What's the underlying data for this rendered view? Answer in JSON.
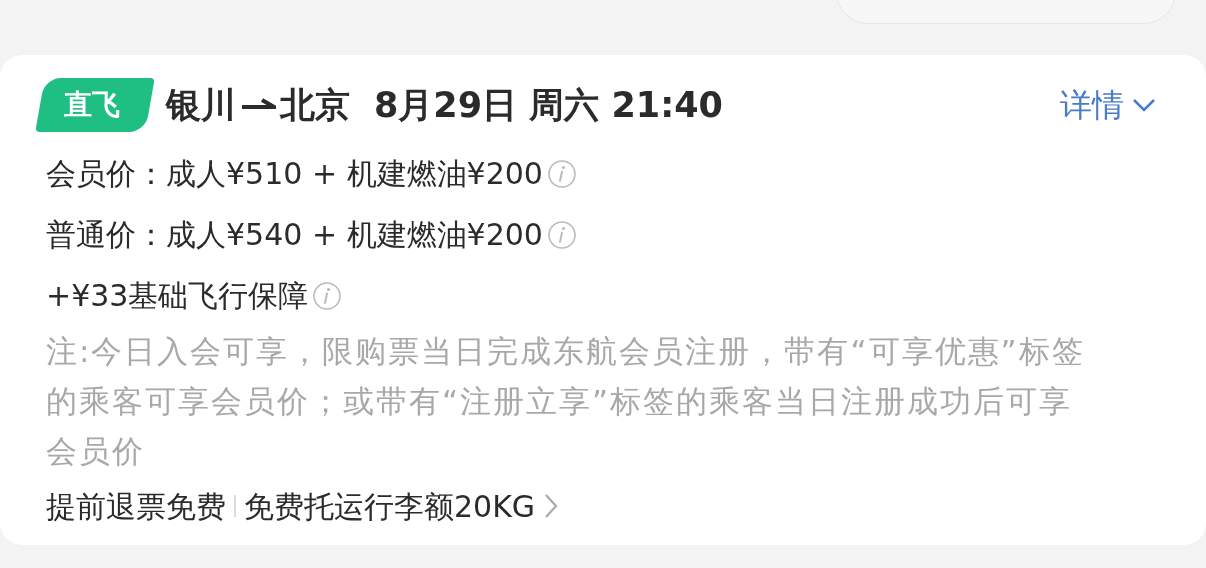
{
  "flight": {
    "badge": "直飞",
    "from": "银川",
    "to": "北京",
    "datetime": "8月29日 周六 21:40",
    "details_link": "详情"
  },
  "prices": [
    {
      "text": "会员价：成人¥510 + 机建燃油¥200",
      "info": true
    },
    {
      "text": "普通价：成人¥540 + 机建燃油¥200",
      "info": true
    },
    {
      "text": "+¥33基础飞行保障",
      "info": true
    }
  ],
  "note": "注:今日入会可享，限购票当日完成东航会员注册，带有“可享优惠”标签的乘客可享会员价；或带有“注册立享”标签的乘客当日注册成功后可享会员价",
  "policies": [
    "提前退票免费",
    "免费托运行李额20KG"
  ]
}
